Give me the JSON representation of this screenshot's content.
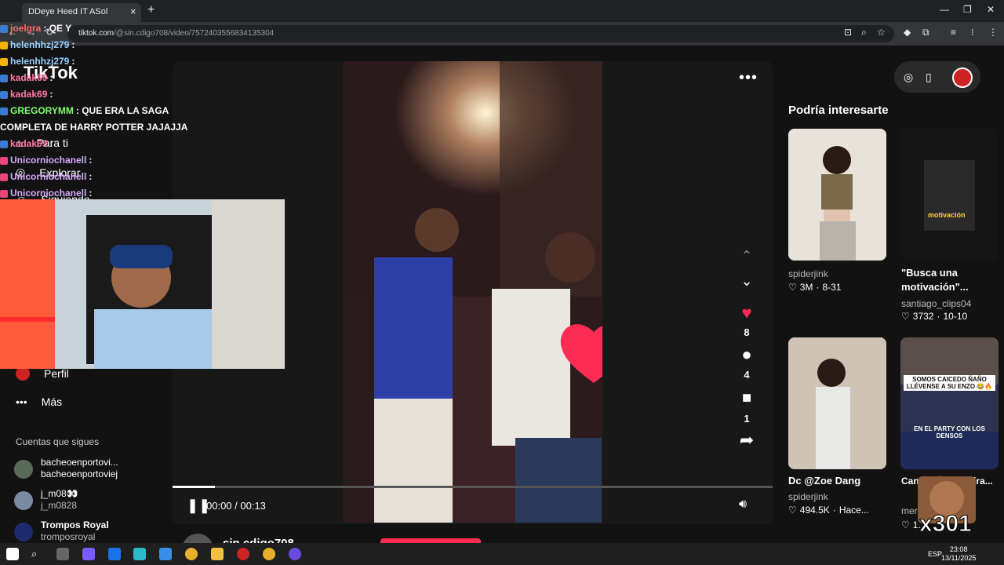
{
  "browser": {
    "tab_title": "DDeye Heed IT ASol",
    "tab_close": "×",
    "new_tab": "+",
    "url_domain": "tiktok.com",
    "url_path": "/@sin.cdigo708/video/7572403556834135304",
    "min": "—",
    "max": "❐",
    "close": "✕"
  },
  "nav": {
    "logo": "TikTok",
    "items": [
      {
        "icon": "home-icon",
        "label": "Para ti"
      },
      {
        "icon": "explore-icon",
        "label": "Explorar"
      },
      {
        "icon": "following-icon",
        "label": "Siguiendo"
      },
      {
        "icon": "profile-icon",
        "label": "Perfil"
      },
      {
        "icon": "more-icon",
        "label": "Más"
      }
    ],
    "following_title": "Cuentas que sigues",
    "accounts": [
      {
        "name": "bacheoenportovi...",
        "username": "bacheoenportoviej"
      },
      {
        "name": "j_m08👀",
        "username": "j_m0828"
      },
      {
        "name": "Trompos Royal",
        "username": "tromposroyal"
      }
    ]
  },
  "video": {
    "more": "•••",
    "likes": "8",
    "comments": "4",
    "saves": "1",
    "time": "00:00 / 00:13",
    "progress": 0.07,
    "author": "sin.cdigo708"
  },
  "recommendations": {
    "title": "Podría interesarte",
    "items": [
      {
        "title": "",
        "author": "spiderjink",
        "likes": "3M",
        "date": "8-31"
      },
      {
        "title": "\"Busca una motivación\"...",
        "author": "santiago_clips04",
        "likes": "3732",
        "date": "10-10",
        "overlay": "motivación"
      },
      {
        "title": "Dc @Zoe Dang",
        "author": "spiderjink",
        "likes": "494.5K",
        "date": "Hace..."
      },
      {
        "title": "Canc... 🔥EC #Vira...",
        "author": "mers...",
        "likes": "1...",
        "date": "",
        "overlay1": "SOMOS CAICEDO ÑAÑO LLÉVENSE A SU ENZO 😂🔥",
        "overlay2": "EN EL PARTY CON LOS DENSOS"
      }
    ]
  },
  "chat": {
    "lines": [
      {
        "user": "joelgra",
        "text": ": QE Y",
        "color": "#ff6b6b"
      },
      {
        "user": "helenhhzj279",
        "text": ":",
        "color": "#9ad0ff"
      },
      {
        "user": "helenhhzj279",
        "text": ":",
        "color": "#9ad0ff"
      },
      {
        "user": "kadak69",
        "text": ":",
        "color": "#ff7aa8"
      },
      {
        "user": "kadak69",
        "text": ":",
        "color": "#ff7aa8"
      },
      {
        "user": "GREGORYMM",
        "text": ": QUE ERA LA SAGA",
        "color": "#7dff6b"
      },
      {
        "user": "",
        "text": "COMPLETA DE HARRY POTTER JAJAJJA",
        "color": "#fff"
      },
      {
        "user": "kadak69",
        "text": ":",
        "color": "#ff7aa8"
      },
      {
        "user": "Unicorniochanell",
        "text": ":",
        "color": "#d6a8ff"
      },
      {
        "user": "Unicorniochanell",
        "text": ":",
        "color": "#d6a8ff"
      },
      {
        "user": "Unicorniochanell",
        "text": ":",
        "color": "#d6a8ff"
      }
    ]
  },
  "overlay": {
    "multiplier": "x301"
  },
  "taskbar": {
    "lang": "ESP",
    "time": "23:08",
    "date": "13/11/2025"
  },
  "colors": {
    "tiktok_red": "#fe2c55",
    "background": "#121212"
  }
}
